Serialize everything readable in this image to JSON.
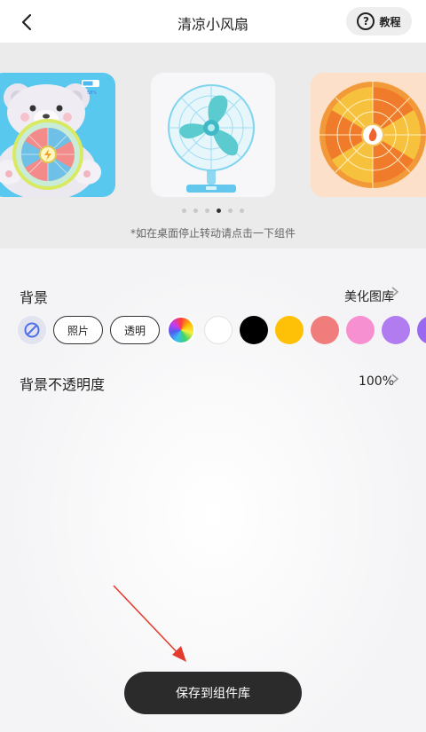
{
  "header": {
    "title": "清凉小风扇",
    "help_label": "教程",
    "help_icon": "question-circle-icon",
    "back_icon": "chevron-left-icon"
  },
  "carousel": {
    "bear_battery_text": "58%",
    "hint": "*如在桌面停止转动请点击一下组件",
    "page_count": 6,
    "active_page": 4
  },
  "settings": {
    "background": {
      "label": "背景",
      "action": "美化图库",
      "options": {
        "none_icon": "no-entry-icon",
        "photo_label": "照片",
        "transparent_label": "透明"
      },
      "swatches": [
        "rainbow",
        "#ffffff",
        "#000000",
        "#ffc107",
        "#f17c7c",
        "#f690d0",
        "#b07cf0",
        "#9b68f0"
      ]
    },
    "opacity": {
      "label": "背景不透明度",
      "value": "100%"
    }
  },
  "save_button": {
    "label": "保存到组件库"
  }
}
